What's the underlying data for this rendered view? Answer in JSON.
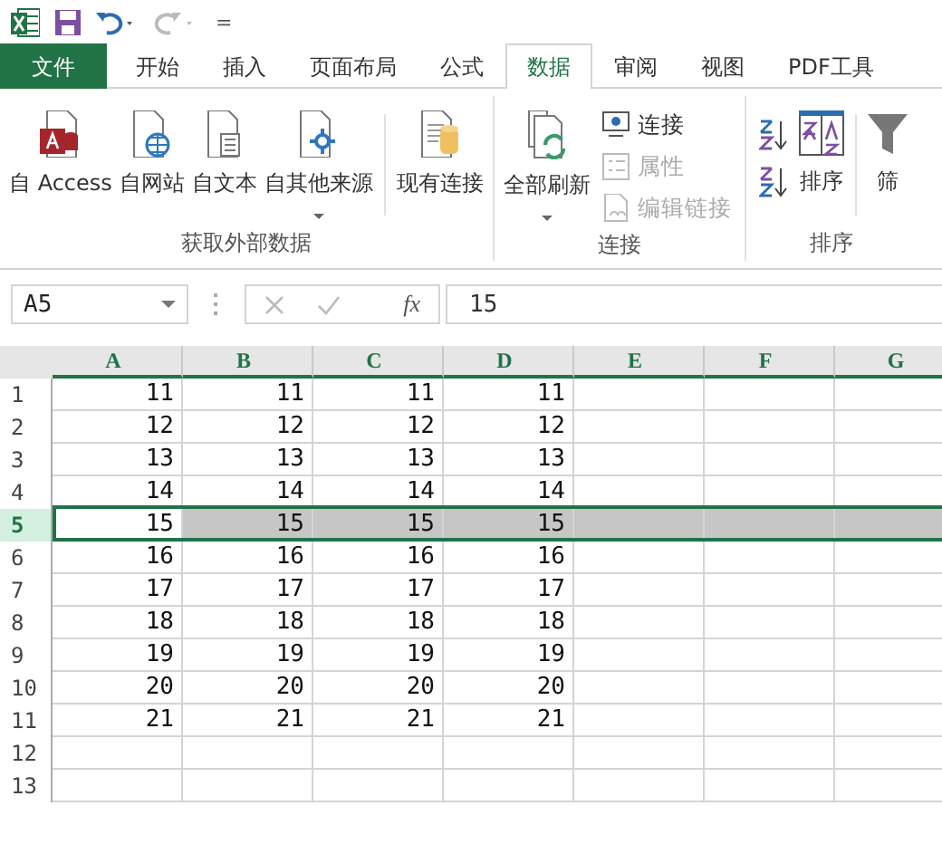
{
  "quick_access": {
    "customize": "="
  },
  "tabs": [
    {
      "label": "文件",
      "kind": "file",
      "selected": false
    },
    {
      "label": "开始",
      "kind": "tab",
      "selected": false
    },
    {
      "label": "插入",
      "kind": "tab",
      "selected": false
    },
    {
      "label": "页面布局",
      "kind": "tab",
      "selected": false
    },
    {
      "label": "公式",
      "kind": "tab",
      "selected": false
    },
    {
      "label": "数据",
      "kind": "tab",
      "selected": true
    },
    {
      "label": "审阅",
      "kind": "tab",
      "selected": false
    },
    {
      "label": "视图",
      "kind": "tab",
      "selected": false
    },
    {
      "label": "PDF工具",
      "kind": "tab",
      "selected": false
    }
  ],
  "ribbon_groups": [
    {
      "label": "获取外部数据",
      "items": [
        {
          "label": "自 Access",
          "kind": "access",
          "has_menu": false
        },
        {
          "label": "自网站",
          "kind": "web",
          "has_menu": false
        },
        {
          "label": "自文本",
          "kind": "text",
          "has_menu": false
        },
        {
          "label": "自其他来源",
          "kind": "other",
          "has_menu": true
        },
        {
          "label": "现有连接",
          "kind": "existing",
          "has_menu": false
        }
      ]
    },
    {
      "label": "连接",
      "items": [
        {
          "label": "全部刷新",
          "kind": "refresh",
          "has_menu": true
        },
        {
          "label": "连接",
          "kind": "small-connect",
          "disabled": false
        },
        {
          "label": "属性",
          "kind": "small-props",
          "disabled": true
        },
        {
          "label": "编辑链接",
          "kind": "small-links",
          "disabled": true
        }
      ]
    },
    {
      "label": "排序",
      "items": [
        {
          "kind": "sort-asc"
        },
        {
          "kind": "sort-desc"
        },
        {
          "label": "排序",
          "kind": "sort",
          "has_menu": false
        },
        {
          "label": "筛",
          "kind": "filter",
          "has_menu": false
        }
      ]
    }
  ],
  "formula_bar": {
    "name_box": "A5",
    "fx": "fx",
    "value": "15"
  },
  "columns": [
    {
      "label": "A",
      "selected": true
    },
    {
      "label": "B",
      "selected": true
    },
    {
      "label": "C",
      "selected": true
    },
    {
      "label": "D",
      "selected": true
    },
    {
      "label": "E",
      "selected": true
    },
    {
      "label": "F",
      "selected": true
    },
    {
      "label": "G",
      "selected": true
    }
  ],
  "rows": [
    {
      "label": "1",
      "selected": false,
      "cells": [
        "11",
        "11",
        "11",
        "11"
      ]
    },
    {
      "label": "2",
      "selected": false,
      "cells": [
        "12",
        "12",
        "12",
        "12"
      ]
    },
    {
      "label": "3",
      "selected": false,
      "cells": [
        "13",
        "13",
        "13",
        "13"
      ]
    },
    {
      "label": "4",
      "selected": false,
      "cells": [
        "14",
        "14",
        "14",
        "14"
      ]
    },
    {
      "label": "5",
      "selected": true,
      "cells": [
        "15",
        "15",
        "15",
        "15"
      ]
    },
    {
      "label": "6",
      "selected": false,
      "cells": [
        "16",
        "16",
        "16",
        "16"
      ]
    },
    {
      "label": "7",
      "selected": false,
      "cells": [
        "17",
        "17",
        "17",
        "17"
      ]
    },
    {
      "label": "8",
      "selected": false,
      "cells": [
        "18",
        "18",
        "18",
        "18"
      ]
    },
    {
      "label": "9",
      "selected": false,
      "cells": [
        "19",
        "19",
        "19",
        "19"
      ]
    },
    {
      "label": "10",
      "selected": false,
      "cells": [
        "20",
        "20",
        "20",
        "20"
      ]
    },
    {
      "label": "11",
      "selected": false,
      "cells": [
        "21",
        "21",
        "21",
        "21"
      ]
    },
    {
      "label": "12",
      "selected": false,
      "cells": []
    },
    {
      "label": "13",
      "selected": false,
      "cells": []
    }
  ]
}
